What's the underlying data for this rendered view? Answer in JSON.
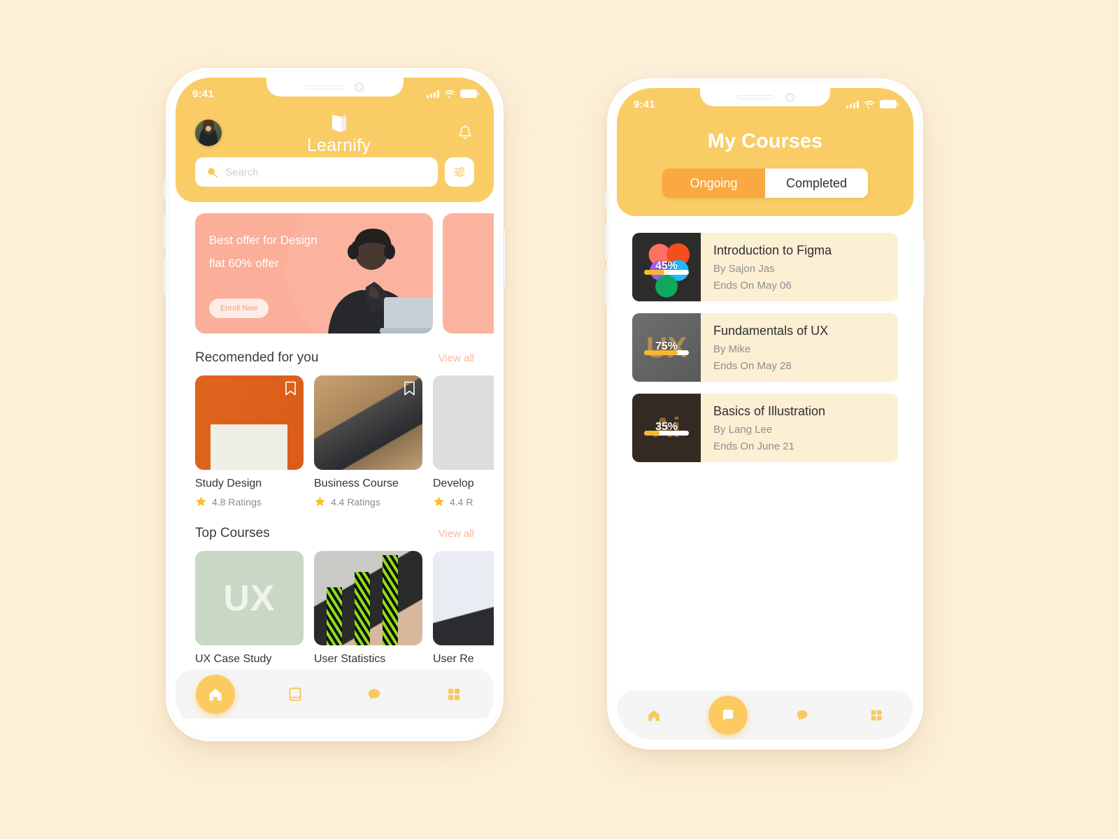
{
  "background_color": "#FDF0D9",
  "accent": {
    "yellow": "#F9CC65",
    "orange": "#F9A93F",
    "salmon": "#FBAE99",
    "card_cream": "#FBEFD4"
  },
  "phone1": {
    "status": {
      "time": "9:41",
      "signal_icon": "cellular-bars-icon",
      "wifi_icon": "wifi-icon",
      "battery_icon": "battery-icon"
    },
    "header": {
      "avatar": "user-avatar",
      "logo_icon": "book-logo-icon",
      "brand": "Learnify",
      "bell_icon": "bell-icon"
    },
    "search": {
      "placeholder": "Search",
      "value": "",
      "icon": "search-icon",
      "filter_icon": "filter-sliders-icon"
    },
    "promo": {
      "line1": "Best offer for Design",
      "line2": "flat 60% offer",
      "cta": "Enroll Now"
    },
    "recommended": {
      "title": "Recomended for you",
      "view_all": "View all",
      "cards": [
        {
          "name": "Study Design",
          "rating": "4.8 Ratings",
          "thumb": "th-study",
          "bookmark": true
        },
        {
          "name": "Business Course",
          "rating": "4.4 Ratings",
          "thumb": "th-business",
          "bookmark": true
        },
        {
          "name": "Develop",
          "rating": "4.4 R",
          "thumb": "th-develop",
          "bookmark": false
        }
      ]
    },
    "top_courses": {
      "title": "Top Courses",
      "view_all": "View all",
      "cards": [
        {
          "name": "UX Case Study",
          "thumb": "th-ux",
          "label": "UX"
        },
        {
          "name": "User Statistics",
          "thumb": "th-stats",
          "label": ""
        },
        {
          "name": "User Re",
          "thumb": "th-report",
          "label": ""
        }
      ]
    },
    "nav": [
      {
        "icon": "home-icon",
        "active": true
      },
      {
        "icon": "book-icon",
        "active": false
      },
      {
        "icon": "chat-bubble-icon",
        "active": false
      },
      {
        "icon": "grid-icon",
        "active": false
      }
    ]
  },
  "phone2": {
    "status": {
      "time": "9:41",
      "signal_icon": "cellular-bars-icon",
      "wifi_icon": "wifi-icon",
      "battery_icon": "battery-icon"
    },
    "title": "My Courses",
    "tabs": [
      {
        "label": "Ongoing",
        "selected": true
      },
      {
        "label": "Completed",
        "selected": false
      }
    ],
    "courses": [
      {
        "title": "Introduction to Figma",
        "author": "By Sajon Jas",
        "ends": "Ends On May 06",
        "progress": 45,
        "progress_label": "45%",
        "art": "art-figma"
      },
      {
        "title": "Fundamentals of UX",
        "author": "By Mike",
        "ends": "Ends On May 28",
        "progress": 75,
        "progress_label": "75%",
        "art": "art-ux"
      },
      {
        "title": "Basics of Illustration",
        "author": "By Lang Lee",
        "ends": "Ends On June 21",
        "progress": 35,
        "progress_label": "35%",
        "art": "art-ai"
      }
    ],
    "nav": [
      {
        "icon": "home-icon",
        "active": false
      },
      {
        "icon": "book-icon",
        "active": true
      },
      {
        "icon": "chat-bubble-icon",
        "active": false
      },
      {
        "icon": "grid-icon",
        "active": false
      }
    ]
  }
}
